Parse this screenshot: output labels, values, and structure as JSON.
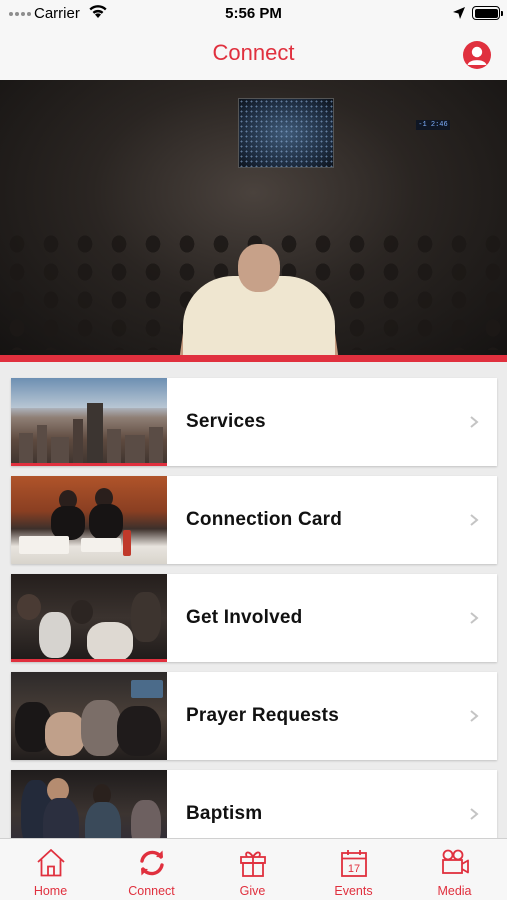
{
  "status_bar": {
    "carrier": "Carrier",
    "time": "5:56 PM"
  },
  "nav": {
    "title": "Connect",
    "profile_icon": "user-circle-icon"
  },
  "hero": {
    "description_icon": "speaker-on-stage-photo",
    "clock_text": "-1 2:46"
  },
  "list": {
    "items": [
      {
        "label": "Services",
        "thumbnail": "city-skyline-photo"
      },
      {
        "label": "Connection Card",
        "thumbnail": "welcome-table-photo"
      },
      {
        "label": "Get Involved",
        "thumbnail": "crowd-photo"
      },
      {
        "label": "Prayer Requests",
        "thumbnail": "group-prayer-photo"
      },
      {
        "label": "Baptism",
        "thumbnail": "baptism-photo"
      }
    ]
  },
  "tabs": [
    {
      "label": "Home",
      "icon": "house-icon"
    },
    {
      "label": "Connect",
      "icon": "refresh-icon",
      "active": true
    },
    {
      "label": "Give",
      "icon": "gift-icon"
    },
    {
      "label": "Events",
      "icon": "calendar-icon",
      "day": "17"
    },
    {
      "label": "Media",
      "icon": "video-camera-icon"
    }
  ],
  "colors": {
    "accent": "#e0303e",
    "bar_background": "#f7f7f7",
    "page_background": "#ececec"
  }
}
